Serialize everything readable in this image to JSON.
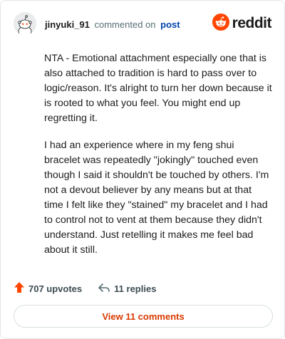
{
  "header": {
    "username": "jinyuki_91",
    "commented_on": "commented on",
    "post_link": "post",
    "brand": "reddit",
    "brand_color": "#ff4500"
  },
  "comment": {
    "paragraphs": [
      "NTA - Emotional attachment especially one that is also attached to tradition is hard to pass over to logic/reason. It's alright to turn her down because it is rooted to what you feel. You might end up regretting it.",
      "I had an experience where in my feng shui bracelet was repeatedly \"jokingly\" touched even though I said it shouldn't be touched by others. I'm not a devout believer by any means but at that time I felt like they \"stained\" my bracelet and I had to control not to vent at them because they didn't understand. Just retelling it makes me feel bad about it still."
    ]
  },
  "stats": {
    "upvotes": "707 upvotes",
    "replies": "11 replies",
    "upvote_icon": "upvote-arrow-icon",
    "reply_icon": "reply-arrow-icon",
    "upvote_color": "#ff4500"
  },
  "footer": {
    "view_comments": "View 11 comments",
    "button_color": "#d93a00"
  }
}
